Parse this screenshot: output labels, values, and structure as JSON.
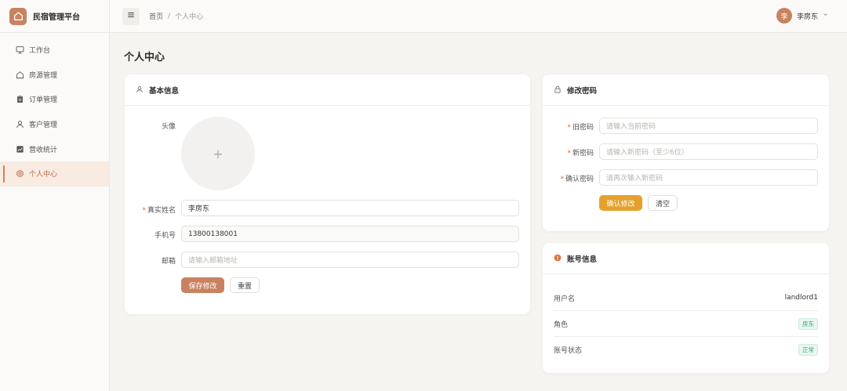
{
  "brand": {
    "title": "民宿管理平台"
  },
  "sidebar": {
    "items": [
      {
        "label": "工作台",
        "icon": "monitor-icon"
      },
      {
        "label": "房源管理",
        "icon": "house-icon"
      },
      {
        "label": "订单管理",
        "icon": "clipboard-icon"
      },
      {
        "label": "客户管理",
        "icon": "user-icon"
      },
      {
        "label": "营收统计",
        "icon": "chart-icon"
      },
      {
        "label": "个人中心",
        "icon": "gear-icon",
        "active": true
      }
    ]
  },
  "header": {
    "breadcrumb": {
      "home": "首页",
      "separator": "/",
      "current": "个人中心"
    },
    "user": {
      "avatar_text": "李",
      "name": "李房东"
    }
  },
  "page": {
    "title": "个人中心"
  },
  "basic_info": {
    "title": "基本信息",
    "avatar_label": "头像",
    "avatar_plus": "+",
    "name_label": "真实姓名",
    "name_value": "李房东",
    "phone_label": "手机号",
    "phone_value": "13800138001",
    "email_label": "邮箱",
    "email_placeholder": "请输入邮箱地址",
    "save_label": "保存修改",
    "reset_label": "重置",
    "required_mark": "*"
  },
  "password": {
    "title": "修改密码",
    "old_label": "旧密码",
    "old_placeholder": "请输入当前密码",
    "new_label": "新密码",
    "new_placeholder": "请输入新密码（至少6位）",
    "confirm_label": "确认密码",
    "confirm_placeholder": "请再次输入新密码",
    "submit_label": "确认修改",
    "clear_label": "清空",
    "required_mark": "*"
  },
  "account": {
    "title": "账号信息",
    "rows": [
      {
        "key": "用户名",
        "value": "landlord1"
      },
      {
        "key": "角色",
        "tag": "房东"
      },
      {
        "key": "账号状态",
        "tag": "正常"
      }
    ]
  },
  "colors": {
    "accent": "#c8825f",
    "save_button": "#c8825f",
    "confirm_button": "#e4a12b",
    "tag_green": "#3aa873"
  }
}
